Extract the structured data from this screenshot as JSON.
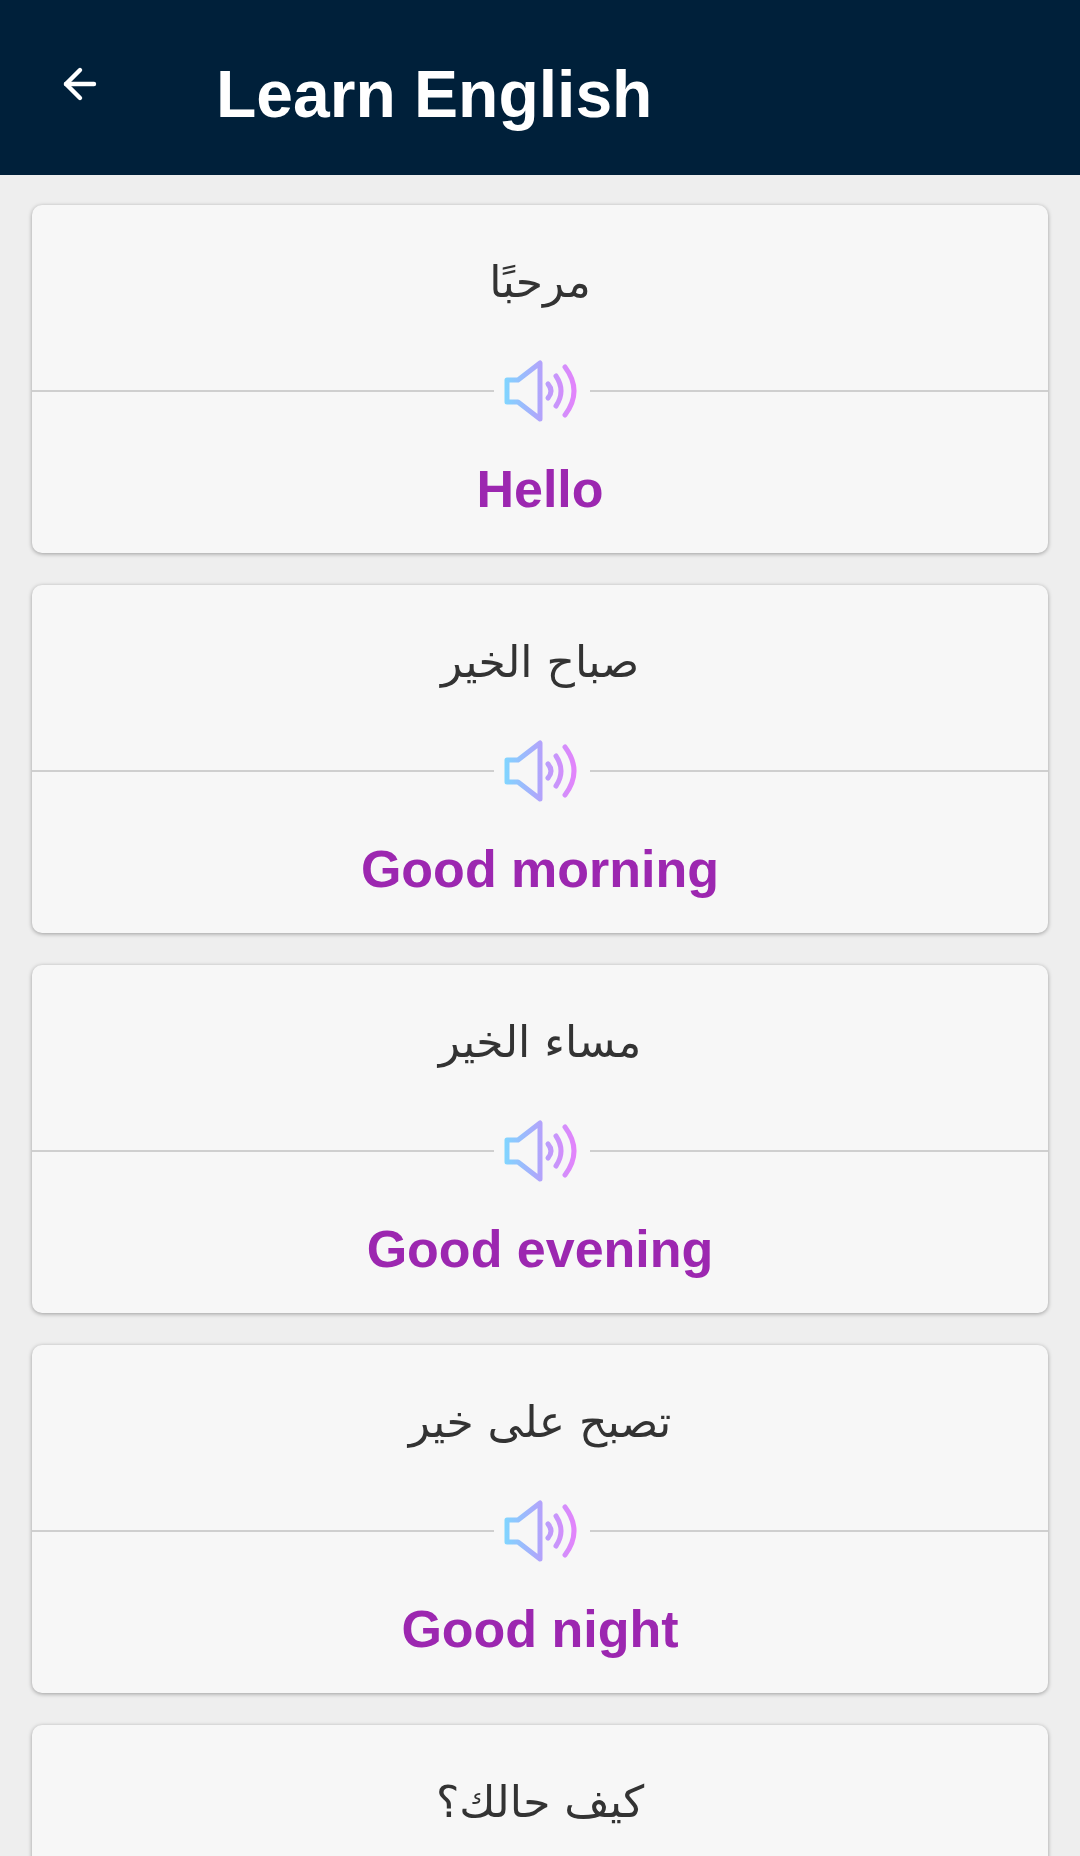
{
  "app_bar": {
    "title": "Learn English"
  },
  "phrases": [
    {
      "arabic": "مرحبًا",
      "english": "Hello"
    },
    {
      "arabic": "صباح الخير",
      "english": "Good morning"
    },
    {
      "arabic": "مساء الخير",
      "english": "Good evening"
    },
    {
      "arabic": "تصبح على خير",
      "english": "Good night"
    },
    {
      "arabic": "كيف حالك؟"
    }
  ]
}
